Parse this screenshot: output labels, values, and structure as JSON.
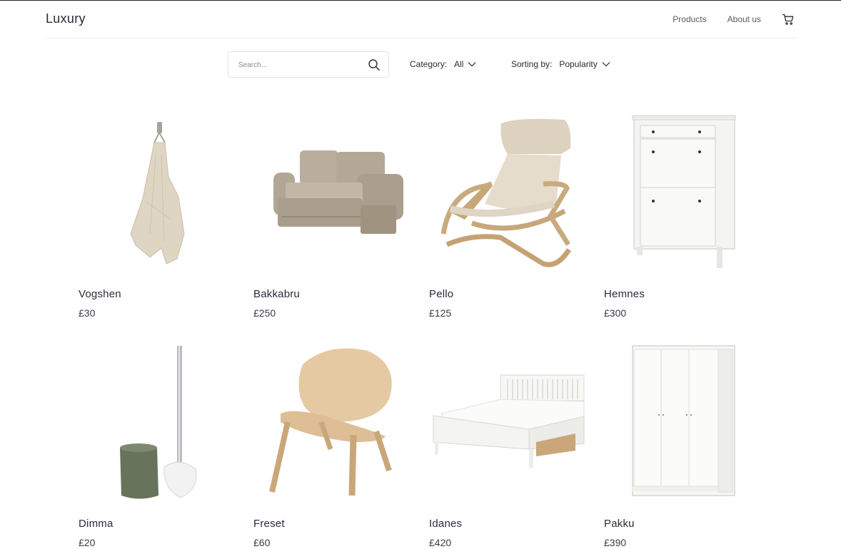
{
  "header": {
    "logo": "Luxury",
    "nav": [
      {
        "label": "Products"
      },
      {
        "label": "About us"
      }
    ],
    "cart_icon": "cart-icon"
  },
  "filters": {
    "search": {
      "placeholder": "Search...",
      "value": "",
      "icon": "search-icon"
    },
    "category": {
      "label": "Category:",
      "value": "All"
    },
    "sorting": {
      "label": "Sorting by:",
      "value": "Popularity"
    }
  },
  "products": [
    {
      "name": "Vogshen",
      "price": "£30"
    },
    {
      "name": "Bakkabru",
      "price": "£250"
    },
    {
      "name": "Pello",
      "price": "£125"
    },
    {
      "name": "Hemnes",
      "price": "£300"
    },
    {
      "name": "Dimma",
      "price": "£20"
    },
    {
      "name": "Freset",
      "price": "£60"
    },
    {
      "name": "Idanes",
      "price": "£420"
    },
    {
      "name": "Pakku",
      "price": "£390"
    }
  ]
}
